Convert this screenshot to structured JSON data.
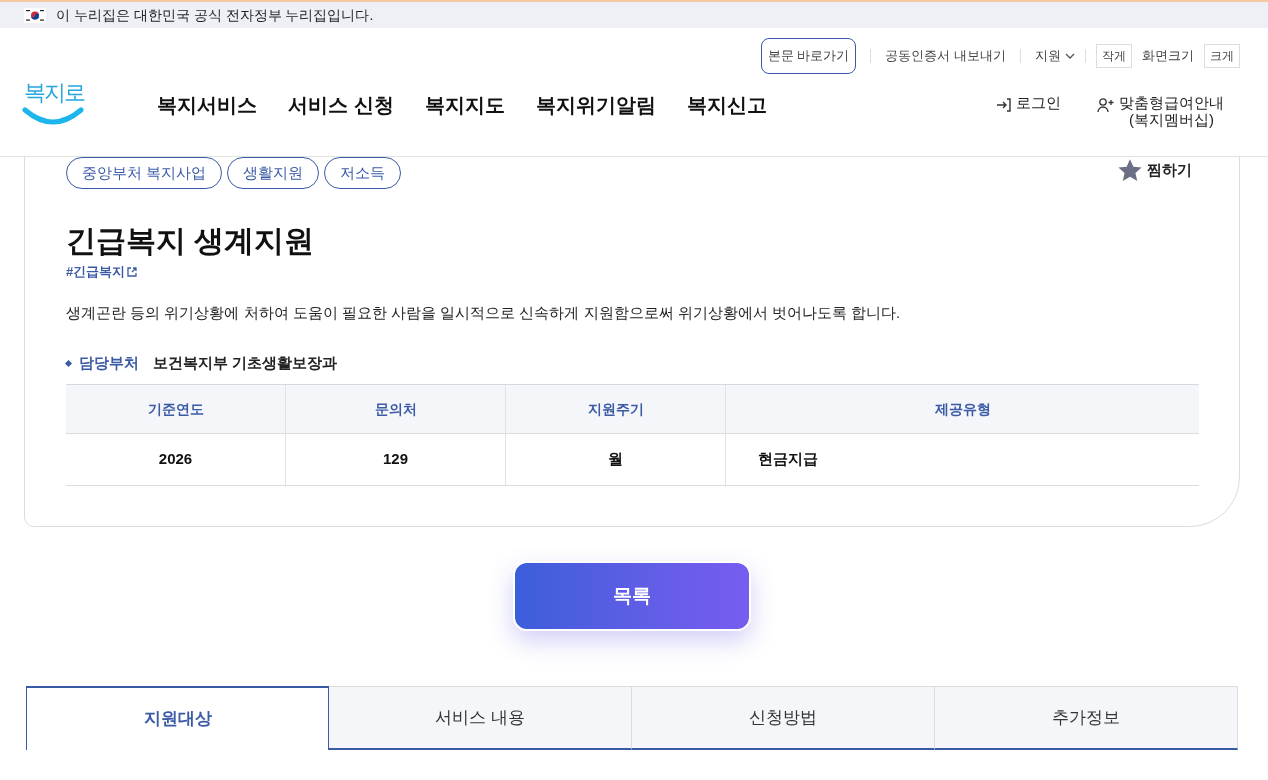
{
  "gov_banner": {
    "text": "이 누리집은 대한민국 공식 전자정부 누리집입니다."
  },
  "utility_links": [
    {
      "kind": "outlined",
      "label": "본문 바로가기"
    },
    {
      "kind": "plain",
      "label": "공동인증서 내보내기"
    },
    {
      "kind": "dropdown",
      "label": "지원"
    }
  ],
  "font_size": {
    "smaller": "작게",
    "label": "화면크기",
    "larger": "크게"
  },
  "logo": {
    "text": "복지로"
  },
  "nav": [
    "복지서비스",
    "서비스 신청",
    "복지지도",
    "복지위기알림",
    "복지신고"
  ],
  "account": [
    {
      "kind": "login",
      "label": "로그인"
    },
    {
      "kind": "member",
      "label": "맞춤형급여안내\n(복지멤버십)"
    }
  ],
  "tags": [
    "중앙부처 복지사업",
    "생활지원",
    "저소득"
  ],
  "bookmark": {
    "label": "찜하기",
    "selected": false
  },
  "title": "긴급복지 생계지원",
  "hashtag": "#긴급복지",
  "description": "생계곤란 등의 위기상황에 처하여 도움이 필요한 사람을 일시적으로 신속하게 지원함으로써 위기상황에서 벗어나도록 합니다.",
  "department": {
    "label": "담당부처",
    "value": "보건복지부 기초생활보장과"
  },
  "table": {
    "columns": [
      "기준연도",
      "문의처",
      "지원주기",
      "제공유형"
    ],
    "rows": [
      [
        "2026",
        "129",
        "월",
        "현금지급"
      ]
    ]
  },
  "list_button": "목록",
  "tabs": [
    {
      "label": "지원대상",
      "selected": true
    },
    {
      "label": "서비스 내용",
      "selected": false
    },
    {
      "label": "신청방법",
      "selected": false
    },
    {
      "label": "추가정보",
      "selected": false
    }
  ]
}
